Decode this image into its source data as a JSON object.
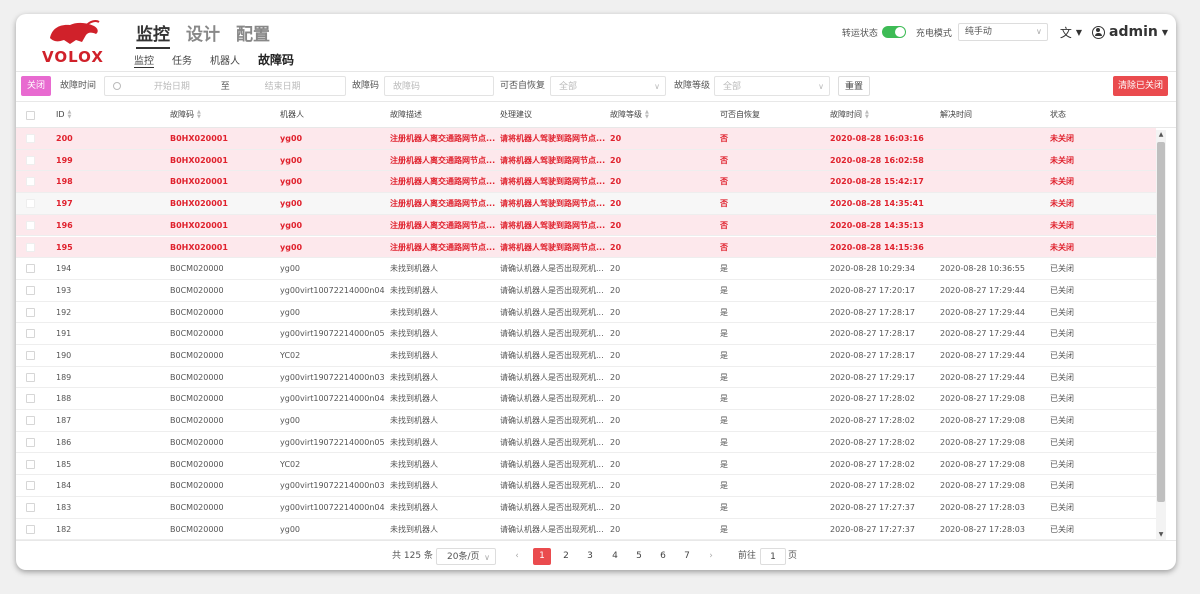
{
  "logo": {
    "text": "VOLOX"
  },
  "main_nav": [
    "监控",
    "设计",
    "配置"
  ],
  "sub_nav": [
    "监控",
    "任务",
    "机器人",
    "故障码"
  ],
  "header_right": {
    "tracking_label": "转运状态",
    "charge_label": "充电模式",
    "charge_mode": "纯手动",
    "user": "admin"
  },
  "filter": {
    "close_label": "关闭",
    "fault_time_label": "故障时间",
    "start_placeholder": "开始日期",
    "to_label": "至",
    "end_placeholder": "结束日期",
    "code_label": "故障码",
    "code_placeholder": "故障码",
    "recoverable_label": "可否自恢复",
    "recoverable_value": "全部",
    "level_label": "故障等级",
    "level_value": "全部",
    "reset_label": "重置",
    "clear_label": "清除已关闭"
  },
  "columns": [
    "ID",
    "故障码",
    "机器人",
    "故障描述",
    "处理建议",
    "故障等级",
    "可否自恢复",
    "故障时间",
    "解决时间",
    "状态"
  ],
  "rows": [
    {
      "id": "200",
      "code": "B0HX020001",
      "robot": "yg00",
      "desc": "注册机器人离交通路网节点...",
      "advice": "请将机器人驾驶到路网节点...",
      "level": "20",
      "recover": "否",
      "time": "2020-08-28 16:03:16",
      "resolve": "",
      "status": "未关闭",
      "fault": true
    },
    {
      "id": "199",
      "code": "B0HX020001",
      "robot": "yg00",
      "desc": "注册机器人离交通路网节点...",
      "advice": "请将机器人驾驶到路网节点...",
      "level": "20",
      "recover": "否",
      "time": "2020-08-28 16:02:58",
      "resolve": "",
      "status": "未关闭",
      "fault": true
    },
    {
      "id": "198",
      "code": "B0HX020001",
      "robot": "yg00",
      "desc": "注册机器人离交通路网节点...",
      "advice": "请将机器人驾驶到路网节点...",
      "level": "20",
      "recover": "否",
      "time": "2020-08-28 15:42:17",
      "resolve": "",
      "status": "未关闭",
      "fault": true
    },
    {
      "id": "197",
      "code": "B0HX020001",
      "robot": "yg00",
      "desc": "注册机器人离交通路网节点...",
      "advice": "请将机器人驾驶到路网节点...",
      "level": "20",
      "recover": "否",
      "time": "2020-08-28 14:35:41",
      "resolve": "",
      "status": "未关闭",
      "fault": true,
      "alt": true
    },
    {
      "id": "196",
      "code": "B0HX020001",
      "robot": "yg00",
      "desc": "注册机器人离交通路网节点...",
      "advice": "请将机器人驾驶到路网节点...",
      "level": "20",
      "recover": "否",
      "time": "2020-08-28 14:35:13",
      "resolve": "",
      "status": "未关闭",
      "fault": true
    },
    {
      "id": "195",
      "code": "B0HX020001",
      "robot": "yg00",
      "desc": "注册机器人离交通路网节点...",
      "advice": "请将机器人驾驶到路网节点...",
      "level": "20",
      "recover": "否",
      "time": "2020-08-28 14:15:36",
      "resolve": "",
      "status": "未关闭",
      "fault": true
    },
    {
      "id": "194",
      "code": "B0CM020000",
      "robot": "yg00",
      "desc": "未找到机器人",
      "advice": "请确认机器人是否出现死机...",
      "level": "20",
      "recover": "是",
      "time": "2020-08-28 10:29:34",
      "resolve": "2020-08-28 10:36:55",
      "status": "已关闭"
    },
    {
      "id": "193",
      "code": "B0CM020000",
      "robot": "yg00virt10072214000n04",
      "desc": "未找到机器人",
      "advice": "请确认机器人是否出现死机...",
      "level": "20",
      "recover": "是",
      "time": "2020-08-27 17:20:17",
      "resolve": "2020-08-27 17:29:44",
      "status": "已关闭"
    },
    {
      "id": "192",
      "code": "B0CM020000",
      "robot": "yg00",
      "desc": "未找到机器人",
      "advice": "请确认机器人是否出现死机...",
      "level": "20",
      "recover": "是",
      "time": "2020-08-27 17:28:17",
      "resolve": "2020-08-27 17:29:44",
      "status": "已关闭"
    },
    {
      "id": "191",
      "code": "B0CM020000",
      "robot": "yg00virt19072214000n05",
      "desc": "未找到机器人",
      "advice": "请确认机器人是否出现死机...",
      "level": "20",
      "recover": "是",
      "time": "2020-08-27 17:28:17",
      "resolve": "2020-08-27 17:29:44",
      "status": "已关闭"
    },
    {
      "id": "190",
      "code": "B0CM020000",
      "robot": "YC02",
      "desc": "未找到机器人",
      "advice": "请确认机器人是否出现死机...",
      "level": "20",
      "recover": "是",
      "time": "2020-08-27 17:28:17",
      "resolve": "2020-08-27 17:29:44",
      "status": "已关闭"
    },
    {
      "id": "189",
      "code": "B0CM020000",
      "robot": "yg00virt19072214000n03",
      "desc": "未找到机器人",
      "advice": "请确认机器人是否出现死机...",
      "level": "20",
      "recover": "是",
      "time": "2020-08-27 17:29:17",
      "resolve": "2020-08-27 17:29:44",
      "status": "已关闭"
    },
    {
      "id": "188",
      "code": "B0CM020000",
      "robot": "yg00virt10072214000n04",
      "desc": "未找到机器人",
      "advice": "请确认机器人是否出现死机...",
      "level": "20",
      "recover": "是",
      "time": "2020-08-27 17:28:02",
      "resolve": "2020-08-27 17:29:08",
      "status": "已关闭"
    },
    {
      "id": "187",
      "code": "B0CM020000",
      "robot": "yg00",
      "desc": "未找到机器人",
      "advice": "请确认机器人是否出现死机...",
      "level": "20",
      "recover": "是",
      "time": "2020-08-27 17:28:02",
      "resolve": "2020-08-27 17:29:08",
      "status": "已关闭"
    },
    {
      "id": "186",
      "code": "B0CM020000",
      "robot": "yg00virt19072214000n05",
      "desc": "未找到机器人",
      "advice": "请确认机器人是否出现死机...",
      "level": "20",
      "recover": "是",
      "time": "2020-08-27 17:28:02",
      "resolve": "2020-08-27 17:29:08",
      "status": "已关闭"
    },
    {
      "id": "185",
      "code": "B0CM020000",
      "robot": "YC02",
      "desc": "未找到机器人",
      "advice": "请确认机器人是否出现死机...",
      "level": "20",
      "recover": "是",
      "time": "2020-08-27 17:28:02",
      "resolve": "2020-08-27 17:29:08",
      "status": "已关闭"
    },
    {
      "id": "184",
      "code": "B0CM020000",
      "robot": "yg00virt19072214000n03",
      "desc": "未找到机器人",
      "advice": "请确认机器人是否出现死机...",
      "level": "20",
      "recover": "是",
      "time": "2020-08-27 17:28:02",
      "resolve": "2020-08-27 17:29:08",
      "status": "已关闭"
    },
    {
      "id": "183",
      "code": "B0CM020000",
      "robot": "yg00virt10072214000n04",
      "desc": "未找到机器人",
      "advice": "请确认机器人是否出现死机...",
      "level": "20",
      "recover": "是",
      "time": "2020-08-27 17:27:37",
      "resolve": "2020-08-27 17:28:03",
      "status": "已关闭"
    },
    {
      "id": "182",
      "code": "B0CM020000",
      "robot": "yg00",
      "desc": "未找到机器人",
      "advice": "请确认机器人是否出现死机...",
      "level": "20",
      "recover": "是",
      "time": "2020-08-27 17:27:37",
      "resolve": "2020-08-27 17:28:03",
      "status": "已关闭"
    }
  ],
  "pagination": {
    "total": "共 125 条",
    "page_size": "20条/页",
    "pages": [
      "1",
      "2",
      "3",
      "4",
      "5",
      "6",
      "7"
    ],
    "prev": "‹",
    "next": "›",
    "goto_label": "前往",
    "goto_value": "1",
    "page_suffix": "页"
  },
  "colors": {
    "accent": "#ea4b4e",
    "fault_text": "#e0222e",
    "fault_bg": "#fde8ec",
    "toggle_on": "#3dbb55",
    "close_btn": "#e86ad0"
  },
  "icons": {
    "language": "translate-icon",
    "user": "user-circle-icon",
    "clock": "clock-icon"
  }
}
